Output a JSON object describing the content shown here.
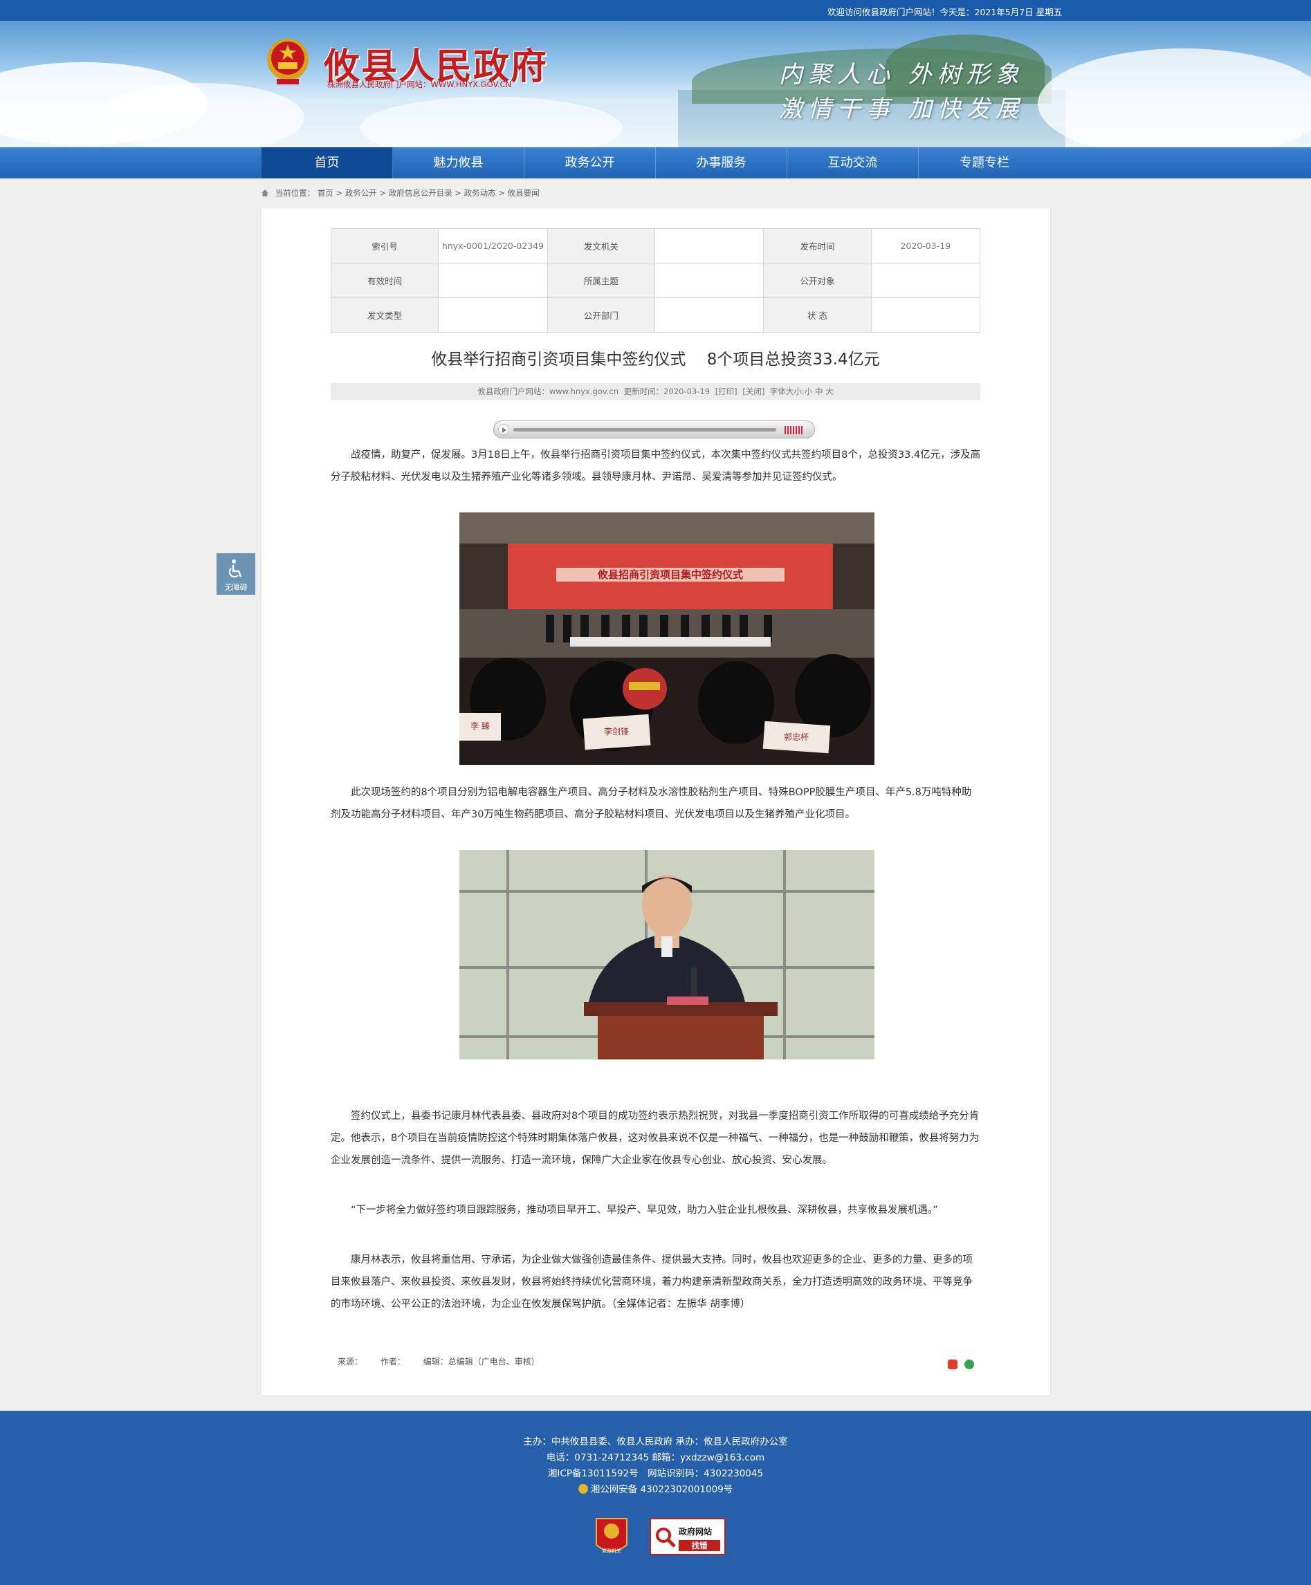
{
  "topbar": {
    "welcome": "欢迎访问攸县政府门户网站！今天是：2021年5月7日 星期五"
  },
  "header": {
    "site_title": "攸县人民政府",
    "site_url": "株洲攸县人民政府门户网站：WWW.HNYX.GOV.CN",
    "slogan_line1": "内聚人心 外树形象",
    "slogan_line2": "激情干事 加快发展"
  },
  "nav": {
    "items": [
      "首页",
      "魅力攸县",
      "政务公开",
      "办事服务",
      "互动交流",
      "专题专栏"
    ],
    "active": "首页"
  },
  "breadcrumb": {
    "label": "当前位置：",
    "items": [
      "首页",
      "政务公开",
      "政府信息公开目录",
      "政务动态",
      "攸县要闻"
    ]
  },
  "meta_table": {
    "rows": [
      [
        {
          "k": "索引号",
          "v": "hnyx-0001/2020-02349"
        },
        {
          "k": "发文机关",
          "v": ""
        },
        {
          "k": "发布时间",
          "v": "2020-03-19"
        }
      ],
      [
        {
          "k": "有效时间",
          "v": ""
        },
        {
          "k": "所属主题",
          "v": ""
        },
        {
          "k": "公开对象",
          "v": ""
        }
      ],
      [
        {
          "k": "发文类型",
          "v": ""
        },
        {
          "k": "公开部门",
          "v": ""
        },
        {
          "k": "状 态",
          "v": ""
        }
      ]
    ]
  },
  "article": {
    "title": "攸县举行招商引资项目集中签约仪式　 8个项目总投资33.4亿元",
    "info": {
      "source": "攸县政府门户网站：www.hnyx.gov.cn",
      "updated": "更新时间：2020-03-19",
      "print": "[打印]",
      "close": "[关闭]",
      "font_size": "字体大小:小 中 大"
    },
    "paragraphs": [
      "战疫情，助复产，促发展。3月18日上午，攸县举行招商引资项目集中签约仪式，本次集中签约仪式共签约项目8个，总投资33.4亿元，涉及高分子胶粘材料、光伏发电以及生猪养殖产业化等诸多领域。县领导康月林、尹诺昂、吴爱清等参加并见证签约仪式。",
      "此次现场签约的8个项目分别为铝电解电容器生产项目、高分子材料及水溶性胶粘剂生产项目、特殊BOPP胶膜生产项目、年产5.8万吨特种助剂及功能高分子材料项目、年产30万吨生物药肥项目、高分子胶粘材料项目、光伏发电项目以及生猪养殖产业化项目。",
      "签约仪式上，县委书记康月林代表县委、县政府对8个项目的成功签约表示热烈祝贺，对我县一季度招商引资工作所取得的可喜成绩给予充分肯定。他表示，8个项目在当前疫情防控这个特殊时期集体落户攸县，这对攸县来说不仅是一种福气、一种福分，也是一种鼓励和鞭策，攸县将努力为企业发展创造一流条件、提供一流服务、打造一流环境，保障广大企业家在攸县专心创业、放心投资、安心发展。",
      "“下一步将全力做好签约项目跟踪服务，推动项目早开工、早投产、早见效，助力入驻企业扎根攸县、深耕攸县，共享攸县发展机遇。”",
      "康月林表示，攸县将重信用、守承诺，为企业做大做强创造最佳条件、提供最大支持。同时，攸县也欢迎更多的企业、更多的力量、更多的项目来攸县落户、来攸县投资、来攸县发财，攸县将始终持续优化营商环境，着力构建亲清新型政商关系，全力打造透明高效的政务环境、平等竞争的市场环境、公平公正的法治环境，为企业在攸发展保驾护航。（全媒体记者：左振华  胡李博）"
    ],
    "photo1": {
      "banner": "攸县招商引资项目集中签约仪式",
      "nameplates": [
        "李 臻",
        "李剑锋",
        "郭忠杯"
      ]
    },
    "footer": {
      "source": "来源：",
      "author": "作者：",
      "editor": "编辑：总编辑（广电台、审核）"
    }
  },
  "accessibility": {
    "label": "无障碍"
  },
  "footer": {
    "line1": "主办：中共攸县县委、攸县人民政府 承办：攸县人民政府办公室",
    "line2": "电话：0731-24712345 邮箱：yxdzzw@163.com",
    "line3": "湘ICP备13011592号　网站识别码：4302230045",
    "line4": "湘公网安备 43022302001009号",
    "badge1_label": "党政机关",
    "badge2_line1": "政府网站",
    "badge2_line2": "找错"
  },
  "colors": {
    "nav": "#1f63b5",
    "nav_active": "#0f4a96",
    "footer": "#2660aa",
    "title_red": "#c41d1d"
  }
}
